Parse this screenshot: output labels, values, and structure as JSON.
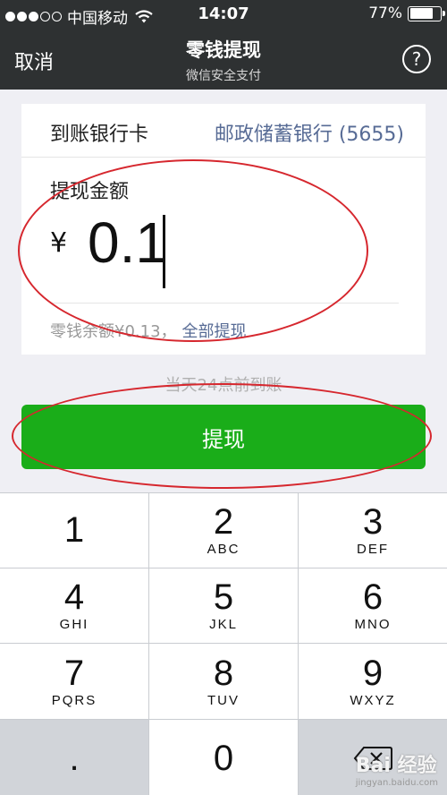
{
  "status_bar": {
    "carrier": "中国移动",
    "time": "14:07",
    "battery": "77%",
    "battery_level": 0.77
  },
  "navbar": {
    "cancel_label": "取消",
    "title": "零钱提现",
    "subtitle": "微信安全支付",
    "help_symbol": "?"
  },
  "form": {
    "bank_label": "到账银行卡",
    "bank_value": "邮政储蓄银行 (5655)",
    "amount_label": "提现金额",
    "currency_symbol": "¥",
    "amount_value": "0.1",
    "balance_text": "零钱余额¥0.13，",
    "withdraw_all_label": "全部提现"
  },
  "arrival_note": "当天24点前到账",
  "withdraw_button_label": "提现",
  "keypad": {
    "keys": [
      {
        "num": "1",
        "letters": ""
      },
      {
        "num": "2",
        "letters": "ABC"
      },
      {
        "num": "3",
        "letters": "DEF"
      },
      {
        "num": "4",
        "letters": "GHI"
      },
      {
        "num": "5",
        "letters": "JKL"
      },
      {
        "num": "6",
        "letters": "MNO"
      },
      {
        "num": "7",
        "letters": "PQRS"
      },
      {
        "num": "8",
        "letters": "TUV"
      },
      {
        "num": "9",
        "letters": "WXYZ"
      },
      {
        "num": ".",
        "letters": ""
      },
      {
        "num": "0",
        "letters": ""
      }
    ]
  },
  "watermark": {
    "brand": "Bai 经验",
    "url": "jingyan.baidu.com"
  },
  "colors": {
    "nav_bg": "#2e3132",
    "accent_green": "#1aad19",
    "link_blue": "#576b95",
    "annotation_red": "#d6272e"
  }
}
